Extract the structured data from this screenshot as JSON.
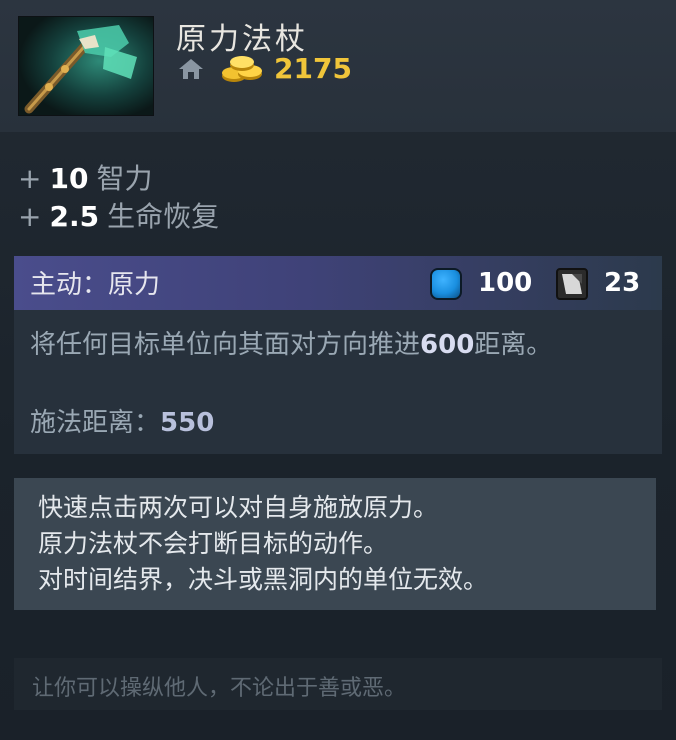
{
  "item": {
    "name": "原力法杖",
    "cost": "2175",
    "icon_name": "force-staff-icon",
    "shop_icon": "home-shop-icon",
    "gold_icon": "gold-coins-icon"
  },
  "stats": [
    {
      "plus": "+",
      "value": "10",
      "label": "智力"
    },
    {
      "plus": "+",
      "value": "2.5",
      "label": "生命恢复"
    }
  ],
  "ability": {
    "title": "主动：原力",
    "mana_cost": "100",
    "cooldown": "23",
    "desc_before": "将任何目标单位向其面对方向推进",
    "desc_value": "600",
    "desc_after": "距离。",
    "cast_range_label": "施法距离：",
    "cast_range_value": "550"
  },
  "notes": [
    "快速点击两次可以对自身施放原力。",
    "原力法杖不会打断目标的动作。",
    "对时间结界，决斗或黑洞内的单位无效。"
  ],
  "lore": "让你可以操纵他人，不论出于善或恶。",
  "colors": {
    "gold": "#f0c53a",
    "mana": "#1a8fe0",
    "ability_header": "#4a4d8c"
  }
}
